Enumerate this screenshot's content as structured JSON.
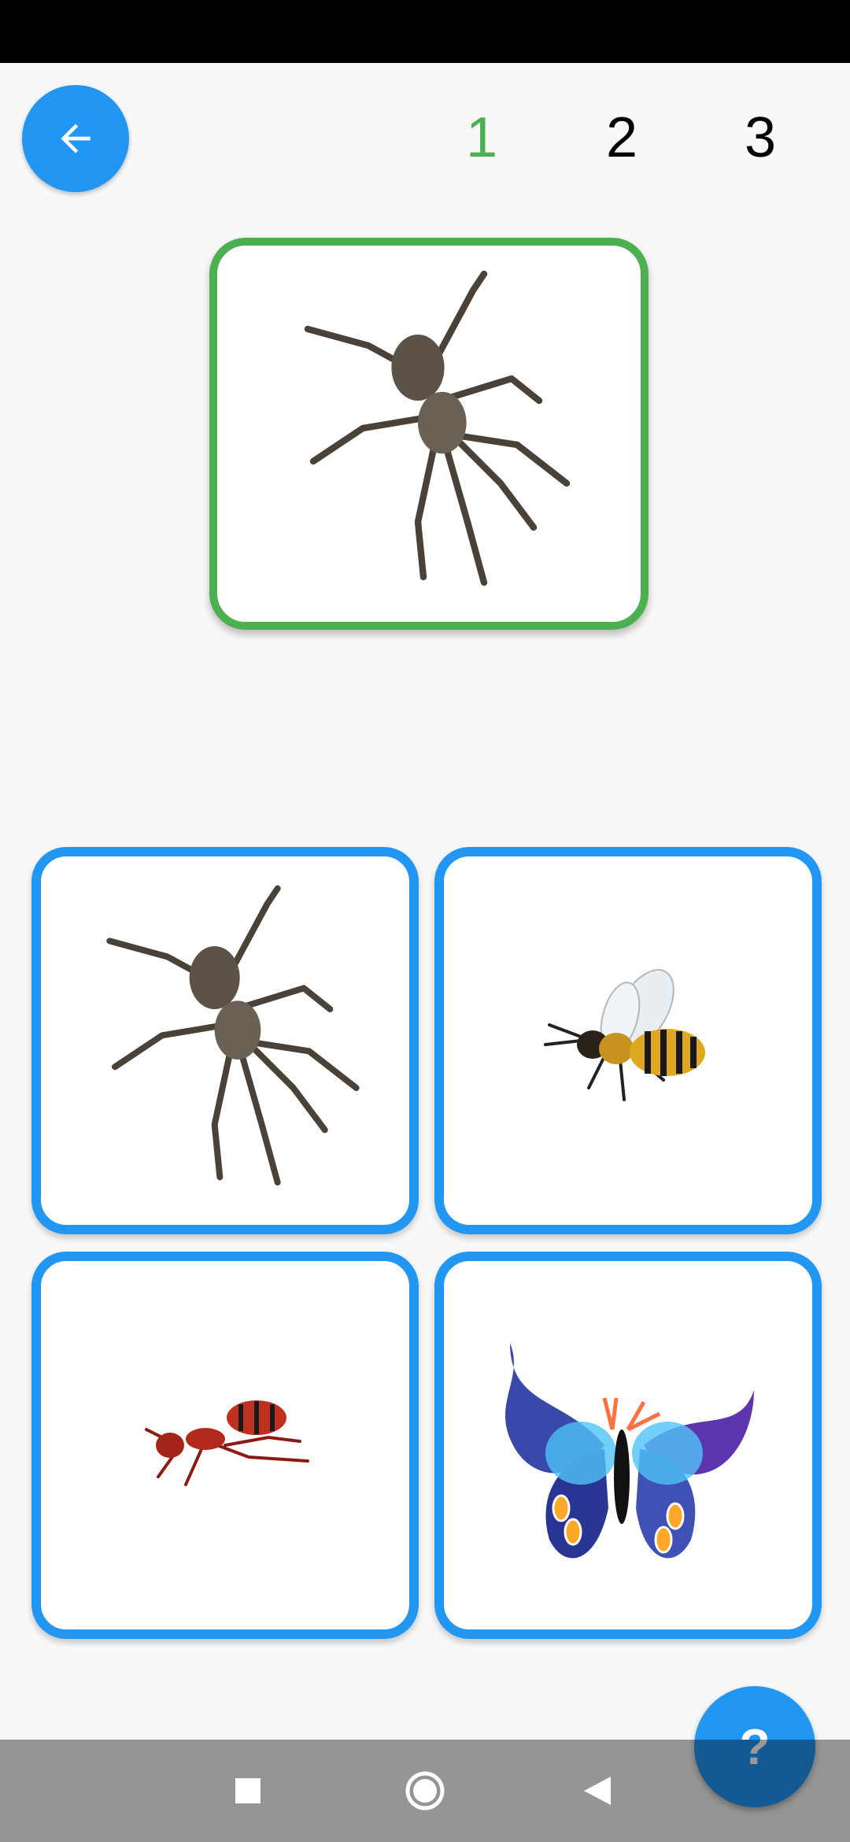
{
  "header": {
    "levels": [
      "1",
      "2",
      "3"
    ],
    "active_level": "1",
    "active_color": "#4caf50"
  },
  "target": {
    "image": "spider-image"
  },
  "choices": [
    {
      "image": "spider-image"
    },
    {
      "image": "bee-image"
    },
    {
      "image": "ant-image"
    },
    {
      "image": "butterfly-image"
    }
  ],
  "help_button": {
    "label": "?"
  },
  "colors": {
    "accent": "#2196f3",
    "correct": "#4caf50"
  }
}
